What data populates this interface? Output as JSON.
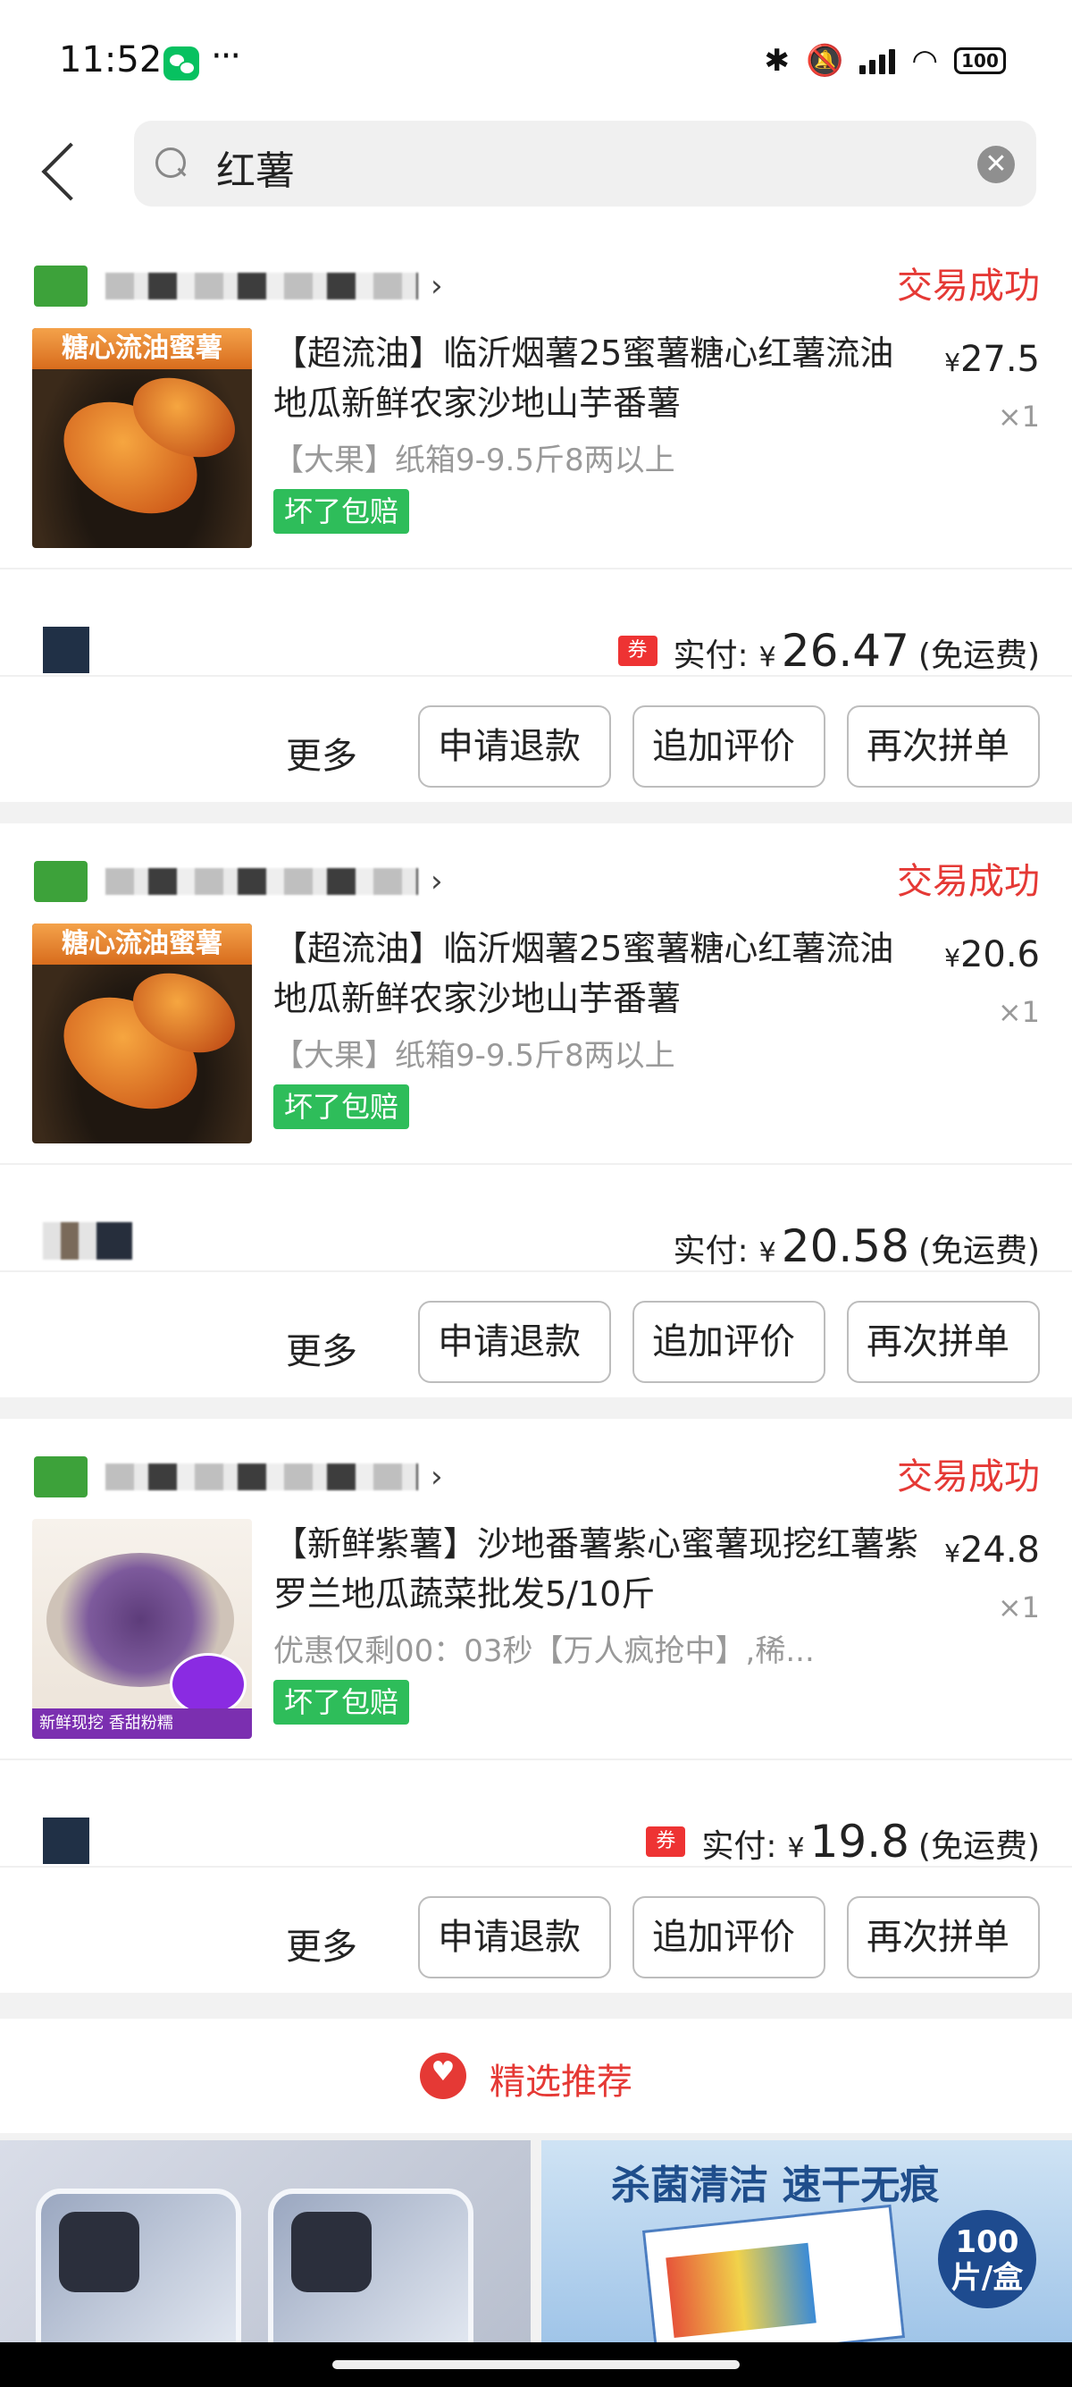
{
  "status_bar": {
    "time": "11:52",
    "dots": "···",
    "battery": "100"
  },
  "search": {
    "query": "红薯",
    "clear_glyph": "✕"
  },
  "orders": [
    {
      "status": "交易成功",
      "thumb_text": "糖心流油蜜薯",
      "title": "【超流油】临沂烟薯25蜜薯糖心红薯流油地瓜新鲜农家沙地山芋番薯",
      "price": "27.5",
      "qty": "×1",
      "spec": "【大果】纸箱9-9.5斤8两以上",
      "badge": "坏了包赔",
      "coupon": "券",
      "paid_label": "实付:",
      "paid_amount": "26.47",
      "shipping": "(免运费)"
    },
    {
      "status": "交易成功",
      "thumb_text": "糖心流油蜜薯",
      "title": "【超流油】临沂烟薯25蜜薯糖心红薯流油地瓜新鲜农家沙地山芋番薯",
      "price": "20.6",
      "qty": "×1",
      "spec": "【大果】纸箱9-9.5斤8两以上",
      "badge": "坏了包赔",
      "paid_label": "实付:",
      "paid_amount": "20.58",
      "shipping": "(免运费)"
    },
    {
      "status": "交易成功",
      "thumb_text": "新鲜现挖 香甜粉糯",
      "title": "【新鲜紫薯】沙地番薯紫心蜜薯现挖红薯紫罗兰地瓜蔬菜批发5/10斤",
      "price": "24.8",
      "qty": "×1",
      "spec": "优惠仅剩00：03秒【万人疯抢中】,稀...",
      "badge": "坏了包赔",
      "coupon": "券",
      "paid_label": "实付:",
      "paid_amount": "19.8",
      "shipping": "(免运费)"
    }
  ],
  "actions": {
    "more": "更多",
    "refund": "申请退款",
    "review": "追加评价",
    "reorder": "再次拼单"
  },
  "currency": "¥",
  "recommend": {
    "label": "精选推荐"
  },
  "banner_right": {
    "headline": "杀菌清洁 速干无痕",
    "circle_top": "100",
    "circle_bottom": "片/盒"
  },
  "colors": {
    "accent_red": "#e53935",
    "badge_green": "#2ebd5a"
  }
}
